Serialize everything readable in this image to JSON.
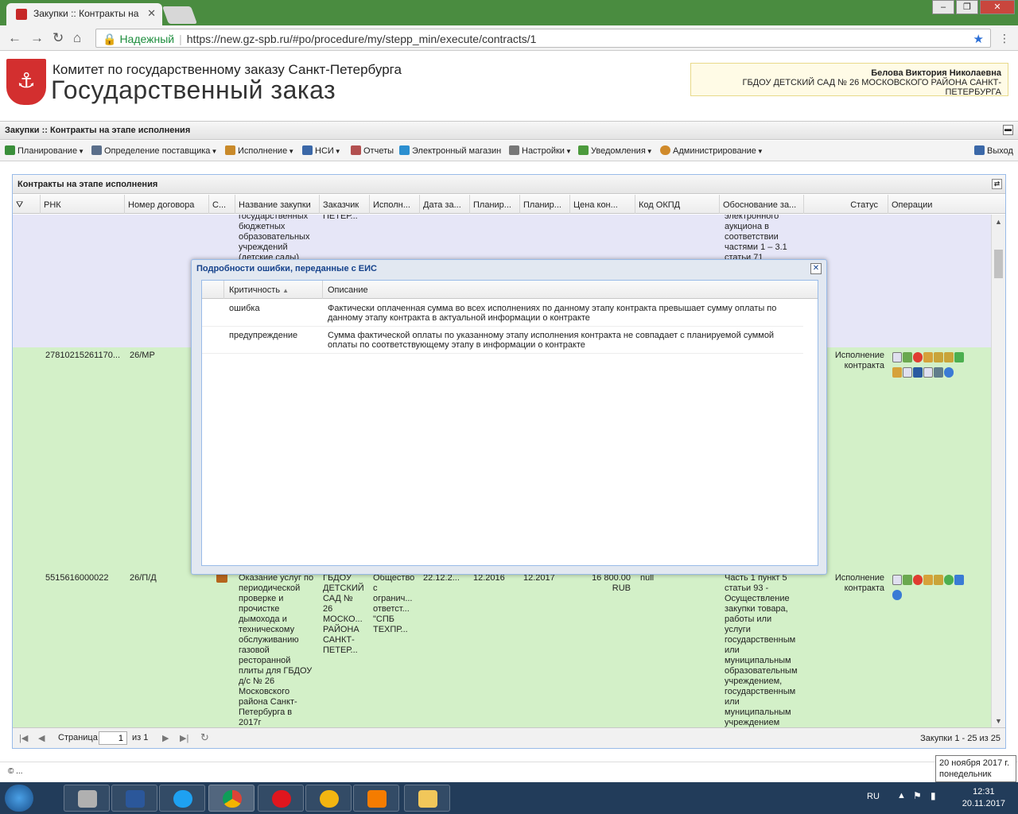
{
  "browser": {
    "tab_title": "Закупки :: Контракты на",
    "secure_label": "Надежный",
    "url": "https://new.gz-spb.ru/#po/procedure/my/stepp_min/execute/contracts/1",
    "window_buttons": [
      "‒",
      "❐",
      "✕"
    ]
  },
  "site": {
    "org_name": "Комитет по государственному заказу Санкт-Петербурга",
    "title": "Государственный заказ",
    "user_name": "Белова Виктория Николаевна",
    "user_org": "ГБДОУ ДЕТСКИЙ САД № 26 МОСКОВСКОГО РАЙОНА САНКТ-ПЕТЕРБУРГА"
  },
  "app": {
    "breadcrumb": "Закупки :: Контракты на этапе исполнения",
    "toolbar": [
      {
        "label": "Планирование",
        "icon": "planning-icon",
        "color": "#3a8f3a",
        "dropdown": true
      },
      {
        "label": "Определение поставщика",
        "icon": "supplier-icon",
        "color": "#5a6e8a",
        "dropdown": true
      },
      {
        "label": "Исполнение",
        "icon": "execution-icon",
        "color": "#c98a2a",
        "dropdown": true
      },
      {
        "label": "НСИ",
        "icon": "reference-book-icon",
        "color": "#3b68a8",
        "dropdown": true
      },
      {
        "label": "Отчеты",
        "icon": "report-icon",
        "color": "#b35050",
        "dropdown": false
      },
      {
        "label": "Электронный магазин",
        "icon": "cart-icon",
        "color": "#2b8fd0",
        "dropdown": false
      },
      {
        "label": "Настройки",
        "icon": "wrench-icon",
        "color": "#777777",
        "dropdown": true
      },
      {
        "label": "Уведомления",
        "icon": "notification-icon",
        "color": "#4c9a3c",
        "dropdown": true
      },
      {
        "label": "Администрирование",
        "icon": "user-icon",
        "color": "#d08a2a",
        "dropdown": true
      }
    ],
    "logout_label": "Выход"
  },
  "grid": {
    "title": "Контракты на этапе исполнения",
    "columns": [
      "РНК",
      "Номер договора",
      "С...",
      "Название закупки",
      "Заказчик",
      "Исполн...",
      "Дата за...",
      "Планир...",
      "Планир...",
      "Цена кон...",
      "Код ОКПД",
      "Обоснование за...",
      "Статус",
      "Операции"
    ],
    "rows": [
      {
        "name": "государственных бюджетных образовательных учреждений (детские сады)",
        "customer": "ПЕТЕР...",
        "basis": "электронного аукциона в соответствии частями 1 – 3.1 статьи 71"
      },
      {
        "rnk": "27810215261170...",
        "contract_no": "26/МР",
        "status": "Исполнение контракта"
      },
      {
        "rnk": "5515616000022",
        "contract_no": "26/П/Д",
        "name": "Оказание услуг по периодической проверке и прочистке дымохода и техническому обслуживанию газовой ресторанной плиты для ГБДОУ д/с № 26 Московского района Санкт-Петербурга в 2017г",
        "customer": "ГБДОУ ДЕТСКИЙ САД № 26 МОСКО... РАЙОНА САНКТ-ПЕТЕР...",
        "executor": "Общество с огранич... ответст... \"СПБ ТЕХПР...",
        "date": "22.12.2...",
        "plan1": "12.2016",
        "plan2": "12.2017",
        "price": "16 800.00 RUB",
        "okpd": "null",
        "basis": "Часть 1 пункт 5 статьи 93 - Осуществление закупки товара, работы или услуги государственным или муниципальным образовательным учреждением, государственным или муниципальным учреждением культуры,",
        "status": "Исполнение контракта"
      }
    ],
    "paging": {
      "page_label": "Страница",
      "page_value": "1",
      "of_label": "из 1",
      "summary": "Закупки 1 - 25 из 25"
    }
  },
  "modal": {
    "title": "Подробности ошибки, переданные с ЕИС",
    "columns": [
      "Критичность",
      "Описание"
    ],
    "rows": [
      {
        "severity": "ошибка",
        "description": "Фактически оплаченная сумма во всех исполнениях по данному этапу контракта превышает сумму оплаты по данному этапу контракта в актуальной информации о контракте"
      },
      {
        "severity": "предупреждение",
        "description": "Сумма фактической оплаты по указанному этапу исполнения контракта не совпадает с планируемой суммой оплаты по соответствующему этапу в информации о контракте"
      }
    ]
  },
  "footer": {
    "copyright": "© ..."
  },
  "os": {
    "tooltip_date": "20 ноября 2017 г.",
    "tooltip_day": "понедельник",
    "lang": "RU",
    "time": "12:31",
    "date": "20.11.2017"
  }
}
